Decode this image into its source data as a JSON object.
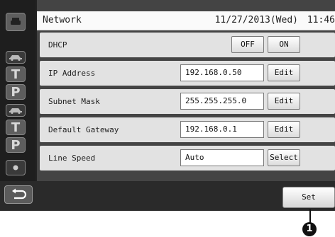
{
  "header": {
    "title": "Network",
    "date": "11/27/2013(Wed)",
    "time": "11:46"
  },
  "rows": {
    "dhcp": {
      "label": "DHCP",
      "off_label": "OFF",
      "on_label": "ON"
    },
    "ip": {
      "label": "IP Address",
      "value": "192.168.0.50",
      "button": "Edit"
    },
    "subnet": {
      "label": "Subnet Mask",
      "value": "255.255.255.0",
      "button": "Edit"
    },
    "gateway": {
      "label": "Default Gateway",
      "value": "192.168.0.1",
      "button": "Edit"
    },
    "speed": {
      "label": "Line Speed",
      "value": "Auto",
      "button": "Select"
    }
  },
  "sidebar": {
    "letters": [
      "T",
      "P",
      "T",
      "P"
    ]
  },
  "footer": {
    "set_label": "Set",
    "callout": "1"
  },
  "icons": [
    "printer-icon",
    "car-icon",
    "car-icon",
    "dot-icon",
    "back-arrow-icon"
  ]
}
